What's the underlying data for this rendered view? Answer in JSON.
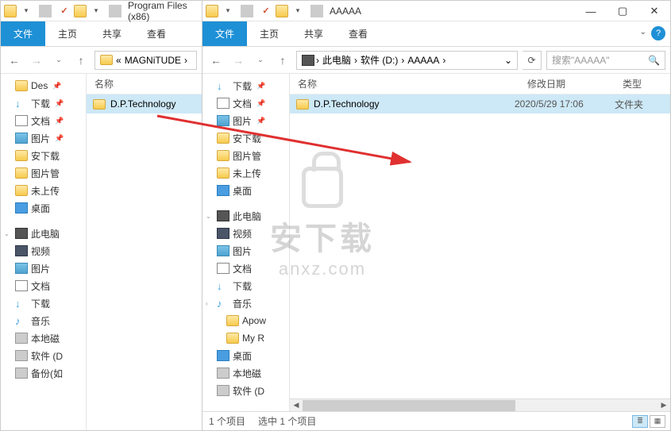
{
  "left": {
    "title": "Program Files (x86)",
    "ribbon": {
      "file": "文件",
      "home": "主页",
      "share": "共享",
      "view": "查看"
    },
    "crumb": [
      "MAGNiTUDE"
    ],
    "nav_quick": [
      {
        "label": "Des",
        "icon": "folder",
        "pin": true
      },
      {
        "label": "下载",
        "icon": "down",
        "pin": true
      },
      {
        "label": "文档",
        "icon": "doc",
        "pin": true
      },
      {
        "label": "图片",
        "icon": "pic",
        "pin": true
      },
      {
        "label": "安下载",
        "icon": "folder"
      },
      {
        "label": "图片管",
        "icon": "folder"
      },
      {
        "label": "未上传",
        "icon": "folder"
      },
      {
        "label": "桌面",
        "icon": "desk"
      }
    ],
    "nav_pc": {
      "label": "此电脑",
      "children": [
        {
          "label": "视频",
          "icon": "vid"
        },
        {
          "label": "图片",
          "icon": "pic"
        },
        {
          "label": "文档",
          "icon": "doc"
        },
        {
          "label": "下载",
          "icon": "down"
        },
        {
          "label": "音乐",
          "icon": "mus"
        },
        {
          "label": "本地磁",
          "icon": "drv"
        },
        {
          "label": "软件 (D",
          "icon": "drv"
        },
        {
          "label": "备份(如",
          "icon": "drv"
        }
      ]
    },
    "header_name": "名称",
    "files": [
      {
        "name": "D.P.Technology"
      }
    ]
  },
  "right": {
    "title": "AAAAA",
    "ribbon": {
      "file": "文件",
      "home": "主页",
      "share": "共享",
      "view": "查看"
    },
    "crumb": [
      "此电脑",
      "软件 (D:)",
      "AAAAA"
    ],
    "search_placeholder": "搜索\"AAAAA\"",
    "nav": [
      {
        "label": "下载",
        "icon": "down",
        "pin": true
      },
      {
        "label": "文档",
        "icon": "doc",
        "pin": true
      },
      {
        "label": "图片",
        "icon": "pic",
        "pin": true
      },
      {
        "label": "安下载",
        "icon": "folder"
      },
      {
        "label": "图片管",
        "icon": "folder"
      },
      {
        "label": "未上传",
        "icon": "folder"
      },
      {
        "label": "桌面",
        "icon": "desk"
      }
    ],
    "nav_pc": {
      "label": "此电脑",
      "children": [
        {
          "label": "视频",
          "icon": "vid"
        },
        {
          "label": "图片",
          "icon": "pic"
        },
        {
          "label": "文档",
          "icon": "doc"
        },
        {
          "label": "下载",
          "icon": "down"
        },
        {
          "label": "音乐",
          "icon": "mus",
          "children": [
            {
              "label": "Apow",
              "icon": "folder"
            },
            {
              "label": "My R",
              "icon": "folder"
            }
          ]
        },
        {
          "label": "桌面",
          "icon": "desk"
        },
        {
          "label": "本地磁",
          "icon": "drv"
        },
        {
          "label": "软件 (D",
          "icon": "drv"
        }
      ]
    },
    "headers": {
      "name": "名称",
      "date": "修改日期",
      "type": "类型"
    },
    "files": [
      {
        "name": "D.P.Technology",
        "date": "2020/5/29 17:06",
        "type": "文件夹"
      }
    ],
    "status": {
      "count": "1 个项目",
      "selected": "选中 1 个项目"
    }
  },
  "watermark": {
    "cn": "安下载",
    "en": "anxz.com"
  }
}
